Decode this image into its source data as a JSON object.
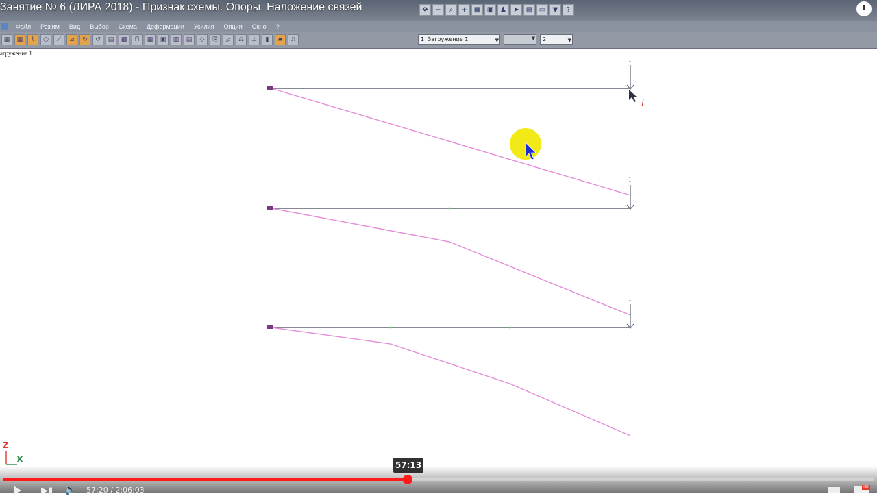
{
  "video": {
    "title": "Занятие № 6 (ЛИРА 2018) - Признак схемы. Опоры. Наложение связей",
    "tooltip_time": "57:13",
    "time_display": "57:20 / 2:06:03",
    "progress": 0.4645
  },
  "menu": {
    "items": [
      "Файл",
      "Режим",
      "Вид",
      "Выбор",
      "Схема",
      "Деформации",
      "Усилия",
      "Опции",
      "Окно",
      "?"
    ]
  },
  "toolbar": {
    "load_case": "1. Загружение 1",
    "number_value": "2"
  },
  "canvas": {
    "load_label": "агружение 1",
    "node_labels": [
      "1",
      "1",
      "1"
    ],
    "cursor_label": "i",
    "axes": {
      "z": "Z",
      "x": "X"
    }
  },
  "colors": {
    "beam": "#5b6270",
    "deformed": "#e48cd9",
    "support": "#7a3a80",
    "highlight_cursor": "#f1ea16",
    "progress": "#ff1a1a"
  },
  "icons": [
    "play-icon",
    "next-icon",
    "volume-icon",
    "settings-icon",
    "hd-icon",
    "clock-icon"
  ]
}
